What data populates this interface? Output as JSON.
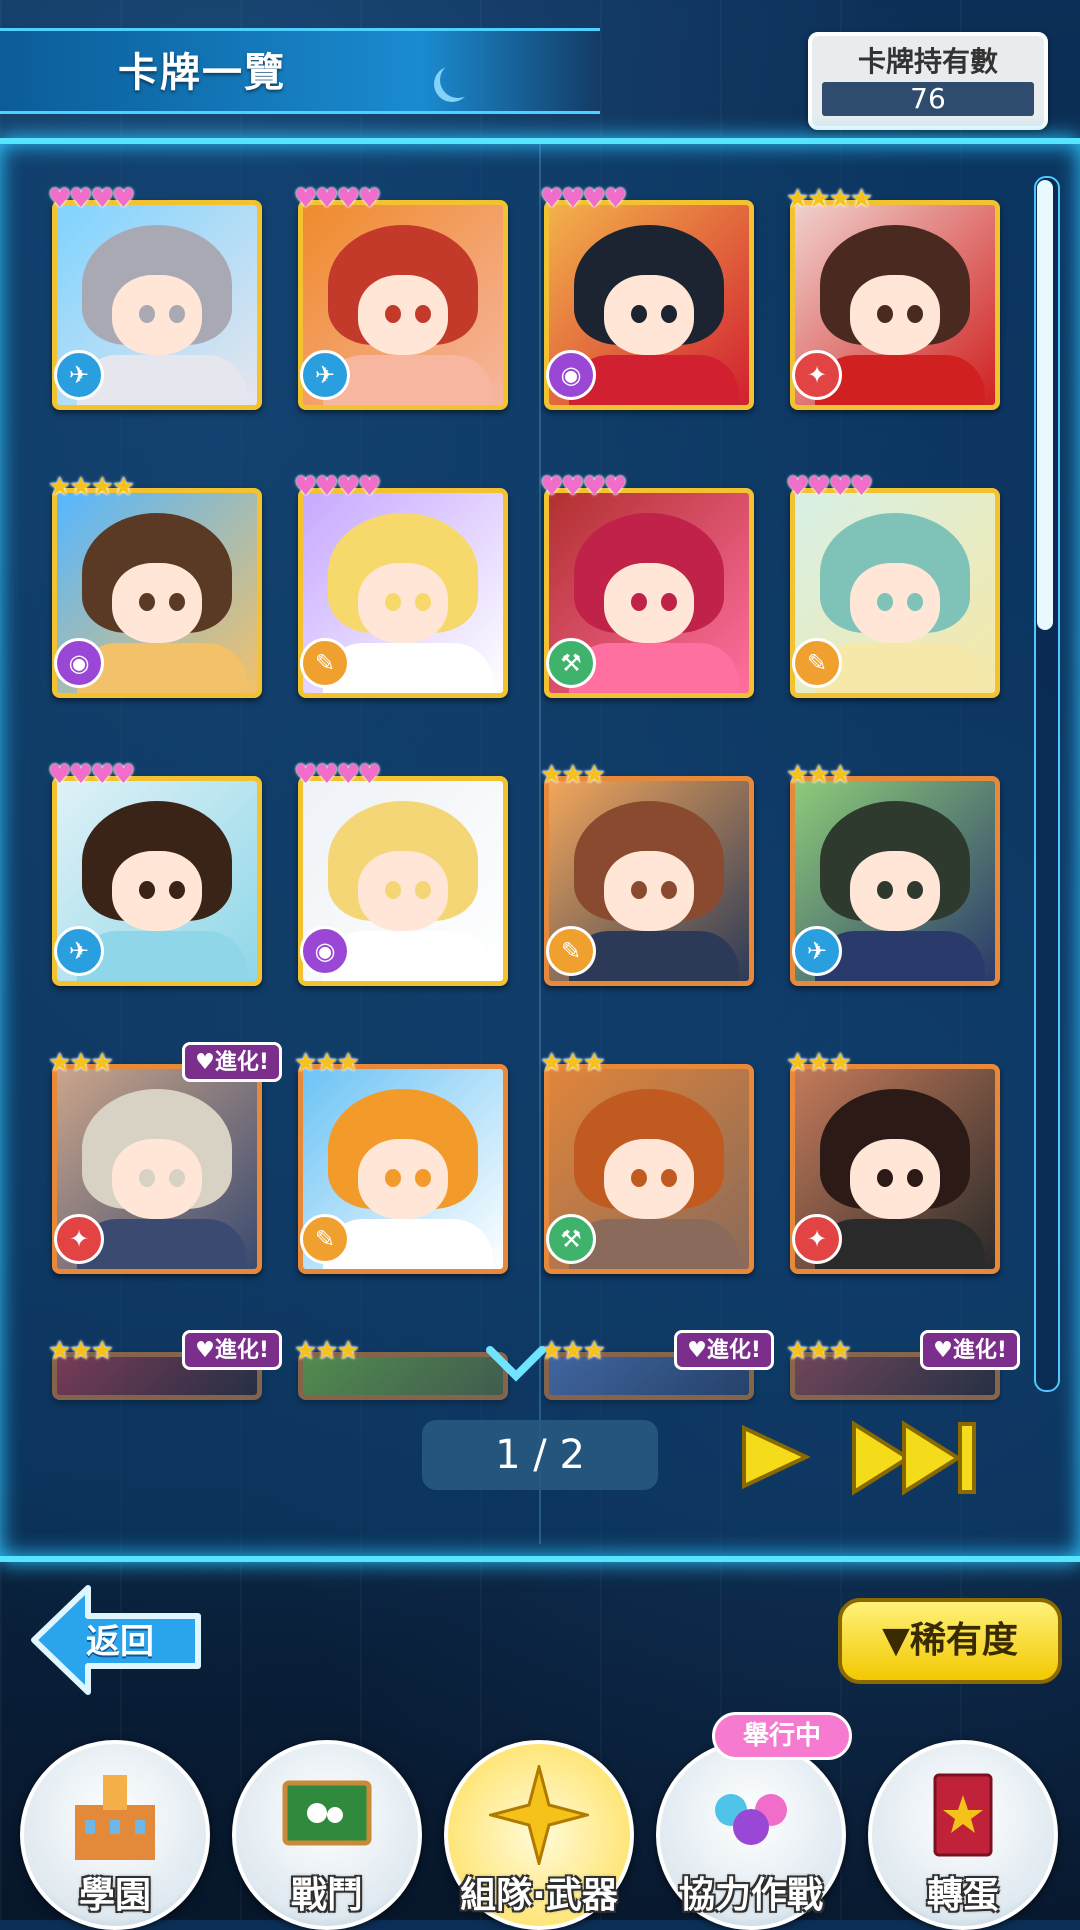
{
  "header": {
    "title": "卡牌一覽"
  },
  "card_count": {
    "label": "卡牌持有數",
    "value": "76"
  },
  "cards": [
    {
      "rating_type": "hearts",
      "rating": "♥♥♥♥",
      "type": "gun",
      "palette": [
        "#7fd3ff",
        "#a9a9b4",
        "#e6e6ee"
      ]
    },
    {
      "rating_type": "hearts",
      "rating": "♥♥♥♥",
      "type": "gun",
      "palette": [
        "#f08a2c",
        "#c33a2a",
        "#f6b6a0"
      ]
    },
    {
      "rating_type": "hearts",
      "rating": "♥♥♥♥",
      "type": "staff",
      "palette": [
        "#f3b24a",
        "#1b2430",
        "#d12030"
      ]
    },
    {
      "rating_type": "stars",
      "rating": "★★★★",
      "type": "sword",
      "palette": [
        "#f0d1cc",
        "#4a2a20",
        "#d02020"
      ]
    },
    {
      "rating_type": "stars",
      "rating": "★★★★",
      "type": "staff",
      "palette": [
        "#55b6ff",
        "#5a3a24",
        "#f2c16a"
      ]
    },
    {
      "rating_type": "hearts",
      "rating": "♥♥♥♥",
      "type": "wand",
      "palette": [
        "#c7a8ff",
        "#f7d96b",
        "#ffffff"
      ]
    },
    {
      "rating_type": "hearts",
      "rating": "♥♥♥♥",
      "type": "hammer",
      "palette": [
        "#b23030",
        "#c0224a",
        "#ff6fa0"
      ]
    },
    {
      "rating_type": "hearts",
      "rating": "♥♥♥♥",
      "type": "wand",
      "palette": [
        "#d7f0e6",
        "#7ec2b8",
        "#f5e8a8"
      ]
    },
    {
      "rating_type": "hearts",
      "rating": "♥♥♥♥",
      "type": "gun",
      "palette": [
        "#dff1f7",
        "#3a2418",
        "#8fd7e8"
      ]
    },
    {
      "rating_type": "hearts",
      "rating": "♥♥♥♥",
      "type": "staff",
      "palette": [
        "#eef2f6",
        "#f5d676",
        "#ffffff"
      ]
    },
    {
      "rating_type": "stars",
      "rating": "★★★",
      "type": "wand",
      "palette": [
        "#f2a65a",
        "#8a4a30",
        "#2c3a58"
      ]
    },
    {
      "rating_type": "stars",
      "rating": "★★★",
      "type": "gun",
      "palette": [
        "#8ecb7a",
        "#2e3a2e",
        "#2a3a6a"
      ]
    },
    {
      "rating_type": "stars",
      "rating": "★★★",
      "type": "sword",
      "palette": [
        "#caa58a",
        "#d8d2c4",
        "#3a4a70"
      ],
      "evolve": "進化!"
    },
    {
      "rating_type": "stars",
      "rating": "★★★",
      "type": "wand",
      "palette": [
        "#6cc3f5",
        "#f29a2a",
        "#ffffff"
      ]
    },
    {
      "rating_type": "stars",
      "rating": "★★★",
      "type": "hammer",
      "palette": [
        "#e0853a",
        "#c05a20",
        "#8a6a5a"
      ]
    },
    {
      "rating_type": "stars",
      "rating": "★★★",
      "type": "sword",
      "palette": [
        "#c47a5a",
        "#2c1a16",
        "#2a2a2a"
      ]
    },
    {
      "rating_type": "stars",
      "rating": "★★★",
      "type": "",
      "palette": [
        "#d04050",
        "#c03030",
        "#3a2a30"
      ],
      "evolve": "進化!"
    },
    {
      "rating_type": "stars",
      "rating": "★★★",
      "type": "",
      "palette": [
        "#8ad040",
        "#c89a30",
        "#6a7a40"
      ]
    },
    {
      "rating_type": "stars",
      "rating": "★★★",
      "type": "",
      "palette": [
        "#6a8ad0",
        "#5a3a2a",
        "#3a4a70"
      ],
      "evolve": "進化!"
    },
    {
      "rating_type": "stars",
      "rating": "★★★",
      "type": "",
      "palette": [
        "#c05050",
        "#7a2a2a",
        "#3a2a2a"
      ],
      "evolve": "進化!"
    }
  ],
  "pager": {
    "text": "1 / 2"
  },
  "buttons": {
    "back": "返回",
    "rarity": "▼稀有度"
  },
  "nav": [
    {
      "label": "學園",
      "icon": "school-building-icon"
    },
    {
      "label": "戰鬥",
      "icon": "blackboard-icon"
    },
    {
      "label": "組隊·武器",
      "icon": "compass-star-icon",
      "active": true
    },
    {
      "label": "協力作戰",
      "icon": "coop-group-icon"
    },
    {
      "label": "轉蛋",
      "icon": "gacha-book-icon"
    }
  ],
  "event_badge": "舉行中",
  "colors": {
    "accent": "#57e4ff",
    "heart": "#f06ec9",
    "star": "#f5c21b"
  }
}
